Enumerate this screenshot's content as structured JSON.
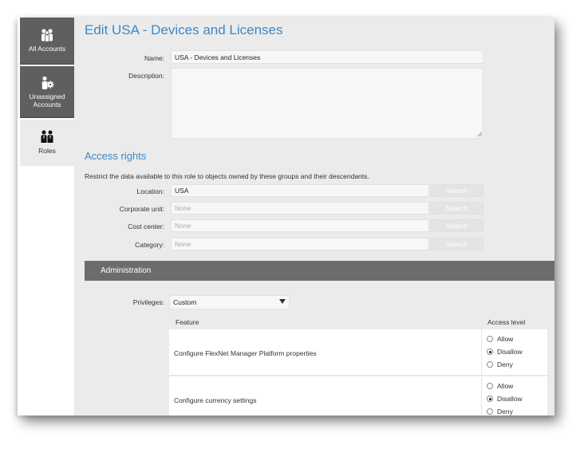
{
  "nav": {
    "items": [
      {
        "label": "All Accounts",
        "icon": "people-group-icon",
        "active": false
      },
      {
        "label": "Unassigned Accounts",
        "icon": "person-gear-icon",
        "active": false
      },
      {
        "label": "Roles",
        "icon": "roles-icon",
        "active": true
      }
    ]
  },
  "page": {
    "title": "Edit USA - Devices and Licenses",
    "name_label": "Name:",
    "name_value": "USA - Devices and Licenses",
    "description_label": "Description:",
    "description_value": ""
  },
  "access_rights": {
    "title": "Access rights",
    "hint": "Restrict the data available to this role to objects owned by these groups and their descendants.",
    "fields": [
      {
        "label": "Location:",
        "value": "USA",
        "placeholder": "",
        "button": "Search"
      },
      {
        "label": "Corporate unit:",
        "value": "",
        "placeholder": "None",
        "button": "Search"
      },
      {
        "label": "Cost center:",
        "value": "",
        "placeholder": "None",
        "button": "Search"
      },
      {
        "label": "Category:",
        "value": "",
        "placeholder": "None",
        "button": "Search"
      }
    ]
  },
  "administration": {
    "title": "Administration",
    "privileges_label": "Privileges:",
    "privileges_value": "Custom",
    "columns": {
      "feature": "Feature",
      "access": "Access level"
    },
    "rows": [
      {
        "feature": "Configure FlexNet Manager Platform properties",
        "options": [
          "Allow",
          "Disallow",
          "Deny"
        ],
        "selected": "Disallow"
      },
      {
        "feature": "Configure currency settings",
        "options": [
          "Allow",
          "Disallow",
          "Deny"
        ],
        "selected": "Disallow"
      }
    ]
  },
  "colors": {
    "accent": "#3c88c8",
    "nav_dark": "#5f5f5f",
    "panel_header": "#6c6c6c",
    "background": "#ebebeb"
  }
}
